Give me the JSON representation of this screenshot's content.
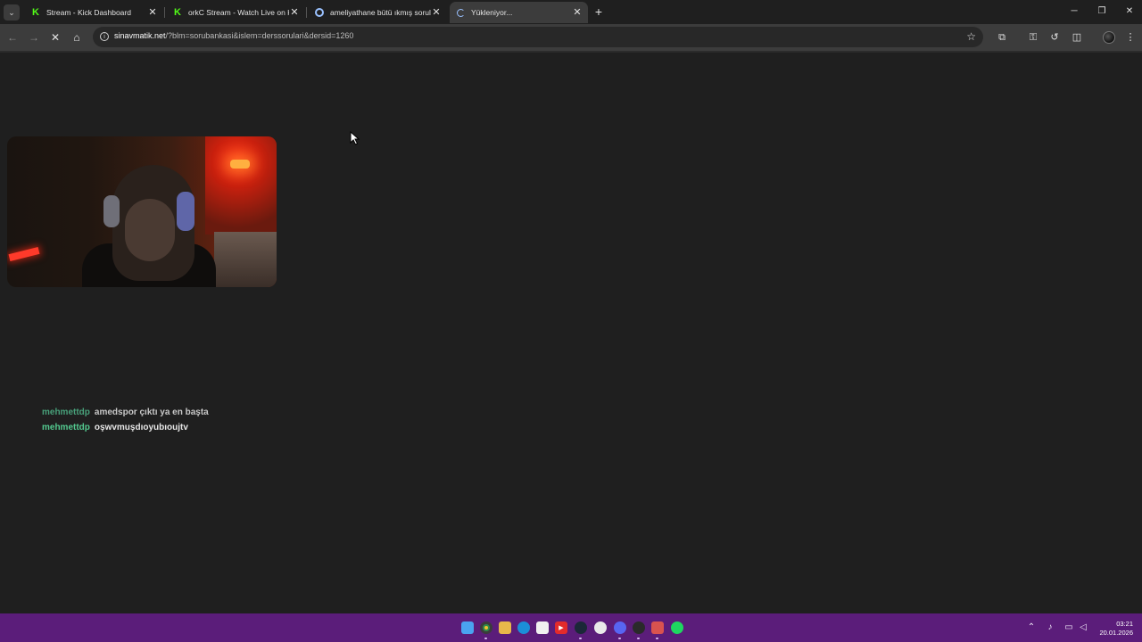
{
  "browser": {
    "tabs": [
      {
        "title": "Stream - Kick Dashboard",
        "favicon": "kick-icon",
        "active": false
      },
      {
        "title": "orkC Stream - Watch Live on Ki",
        "favicon": "kick-icon",
        "active": false
      },
      {
        "title": "ameliyathane bütü ıkmış sorula",
        "favicon": "google-icon",
        "active": false
      },
      {
        "title": "Yükleniyor...",
        "favicon": "loading-spinner-icon",
        "active": true
      }
    ],
    "address": {
      "host": "sinavmatik.net",
      "path": "/?blm=sorubankasi&islem=derssorulari&dersid=1260"
    }
  },
  "chat": {
    "messages": [
      {
        "user": "mehmettdp",
        "text": "amedspor çıktı ya en başta"
      },
      {
        "user": "mehmettdp",
        "text": "oşwvmuşdıoyubıoujtv"
      }
    ]
  },
  "taskbar": {
    "time": "03:21",
    "date": "20.01.2026"
  },
  "colors": {
    "page_bg": "#1f1f1f",
    "toolbar_bg": "#3c3c3c",
    "taskbar_bg": "#5b1d7a",
    "chat_username": "#53c98f",
    "kick_green": "#53fc18"
  }
}
